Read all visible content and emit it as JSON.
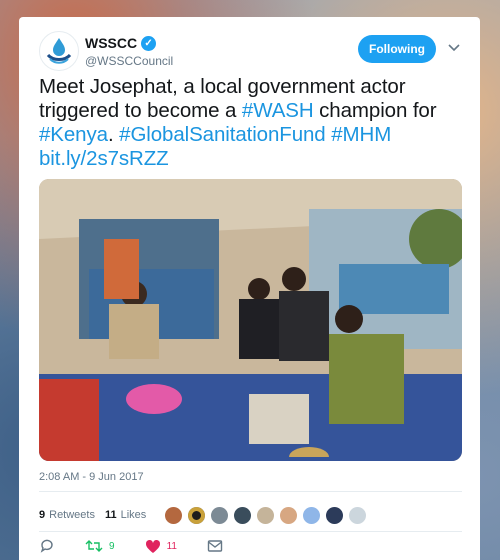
{
  "account": {
    "name": "WSSCC",
    "handle": "@WSSCCouncil",
    "verified": true,
    "follow_label": "Following"
  },
  "tweet": {
    "text_plain_1": "Meet Josephat, a local government actor triggered to become a ",
    "hashtag_wash": "#WASH",
    "text_plain_2": " champion for ",
    "hashtag_kenya": "#Kenya",
    "text_plain_3": ". ",
    "hashtag_gsf": "#GlobalSanitationFund",
    "text_plain_4": " ",
    "hashtag_mhm": "#MHM",
    "link": "bit.ly/2s7sRZZ",
    "timestamp": "2:08 AM - 9 Jun 2017"
  },
  "stats": {
    "retweets_count": "9",
    "retweets_label": "Retweets",
    "likes_count": "11",
    "likes_label": "Likes"
  },
  "actions": {
    "reply_icon": "reply-icon",
    "retweet_count": "9",
    "like_count": "11",
    "dm_icon": "envelope-icon"
  },
  "colors": {
    "accent": "#1da1f2",
    "link": "#1b95e0",
    "retweet": "#17bf63",
    "like": "#e0245e",
    "muted": "#657786",
    "text": "#14171a"
  }
}
